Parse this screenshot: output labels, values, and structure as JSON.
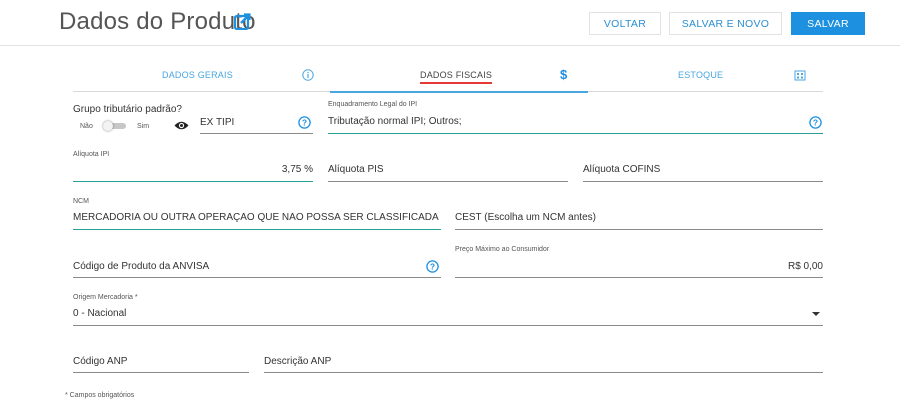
{
  "header": {
    "title": "Dados do Produto",
    "buttons": {
      "voltar": "VOLTAR",
      "salvar_novo": "SALVAR E NOVO",
      "salvar": "SALVAR"
    }
  },
  "tabs": [
    {
      "label": "DADOS GERAIS",
      "icon": "info-icon"
    },
    {
      "label": "DADOS FISCAIS",
      "icon": "dollar-icon",
      "active": true
    },
    {
      "label": "ESTOQUE",
      "icon": "building-icon"
    }
  ],
  "form": {
    "grupo_tributario": {
      "label": "Grupo tributário padrão?",
      "off": "Não",
      "on": "Sim",
      "value": false
    },
    "ex_tipi": {
      "value": "EX TIPI"
    },
    "enquadramento_ipi": {
      "label": "Enquadramento Legal do IPI",
      "value": "Tributação normal IPI; Outros;"
    },
    "aliquota_ipi": {
      "label": "Alíquota IPI",
      "value": "3,75 %"
    },
    "aliquota_pis": {
      "placeholder": "Alíquota PIS"
    },
    "aliquota_cofins": {
      "placeholder": "Alíquota COFINS"
    },
    "ncm": {
      "label": "NCM",
      "value": "MERCADORIA OU OUTRA OPERAÇÃO QUE NÃO POSSA SER CLASSIFICADA SEGUND"
    },
    "cest": {
      "placeholder": "CEST (Escolha um NCM antes)"
    },
    "anvisa": {
      "placeholder": "Código de Produto da ANVISA"
    },
    "preco_maximo": {
      "label": "Preço Máximo ao Consumidor",
      "value": "R$ 0,00"
    },
    "origem": {
      "label": "Origem Mercadoria *",
      "value": "0 - Nacional"
    },
    "codigo_anp": {
      "placeholder": "Código ANP"
    },
    "descricao_anp": {
      "placeholder": "Descrição ANP"
    },
    "footnote": "* Campos obrigatórios"
  },
  "colors": {
    "accent": "#1e90e0",
    "tab_text": "#4aa6df",
    "active_underline": "#e53935",
    "teal_line": "#2aa198"
  }
}
